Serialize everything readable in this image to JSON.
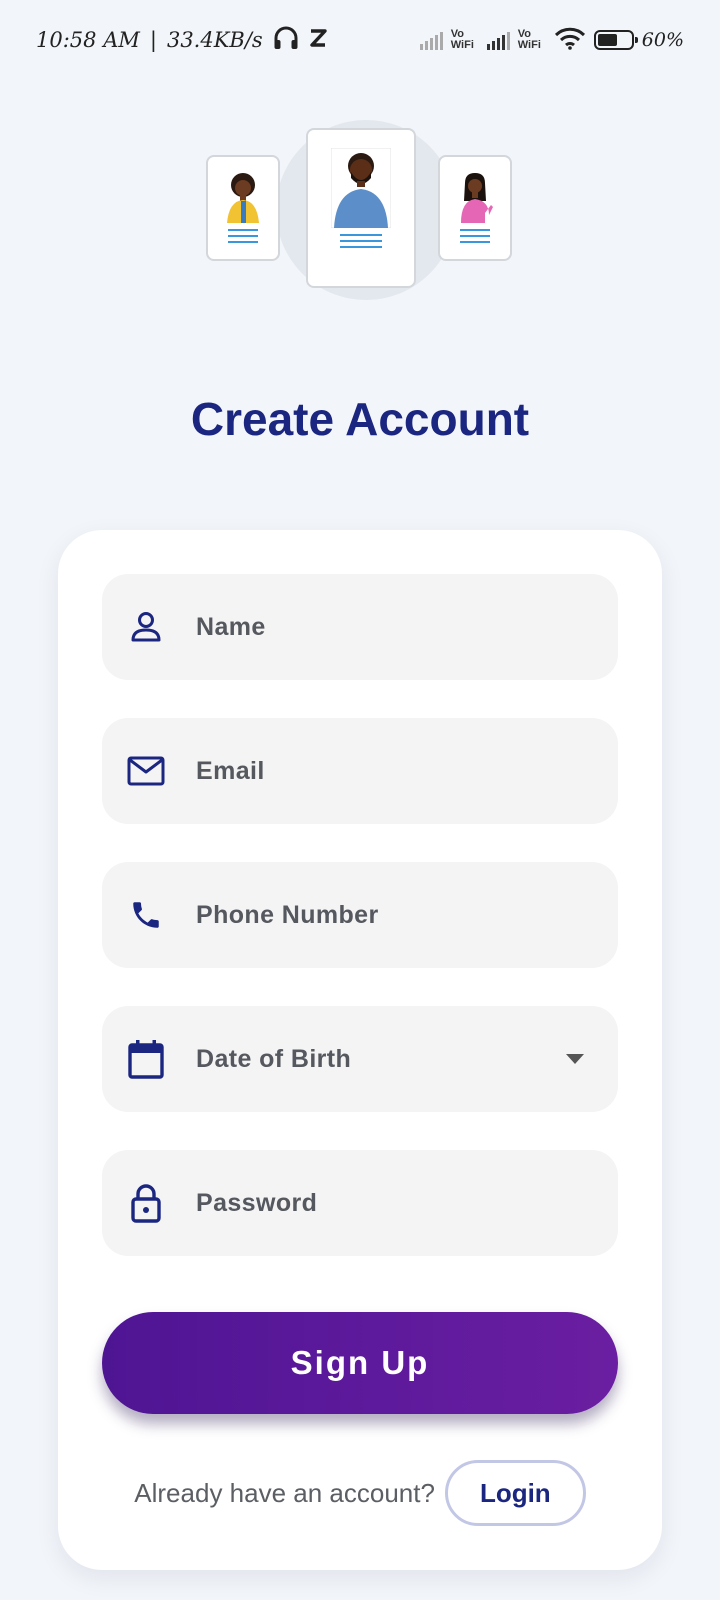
{
  "status_bar": {
    "time": "10:58 AM",
    "network_speed": "33.4KB/s",
    "carrier1": "Vo WiFi",
    "carrier2": "Vo WiFi",
    "battery_percent": "60%",
    "battery_level": 0.6
  },
  "page": {
    "title": "Create Account"
  },
  "form": {
    "fields": [
      {
        "icon": "person-icon",
        "label": "Name"
      },
      {
        "icon": "mail-icon",
        "label": "Email"
      },
      {
        "icon": "phone-icon",
        "label": "Phone Number"
      },
      {
        "icon": "calendar-icon",
        "label": "Date of Birth"
      },
      {
        "icon": "lock-icon",
        "label": "Password"
      }
    ],
    "submit_label": "Sign Up"
  },
  "footer": {
    "prompt": "Already have an account?",
    "login_label": "Login"
  },
  "colors": {
    "primary": "#1b2680",
    "accent_gradient_start": "#4e1593",
    "accent_gradient_end": "#6b1ea1",
    "background": "#f2f5f9",
    "field_background": "#f4f4f5"
  }
}
